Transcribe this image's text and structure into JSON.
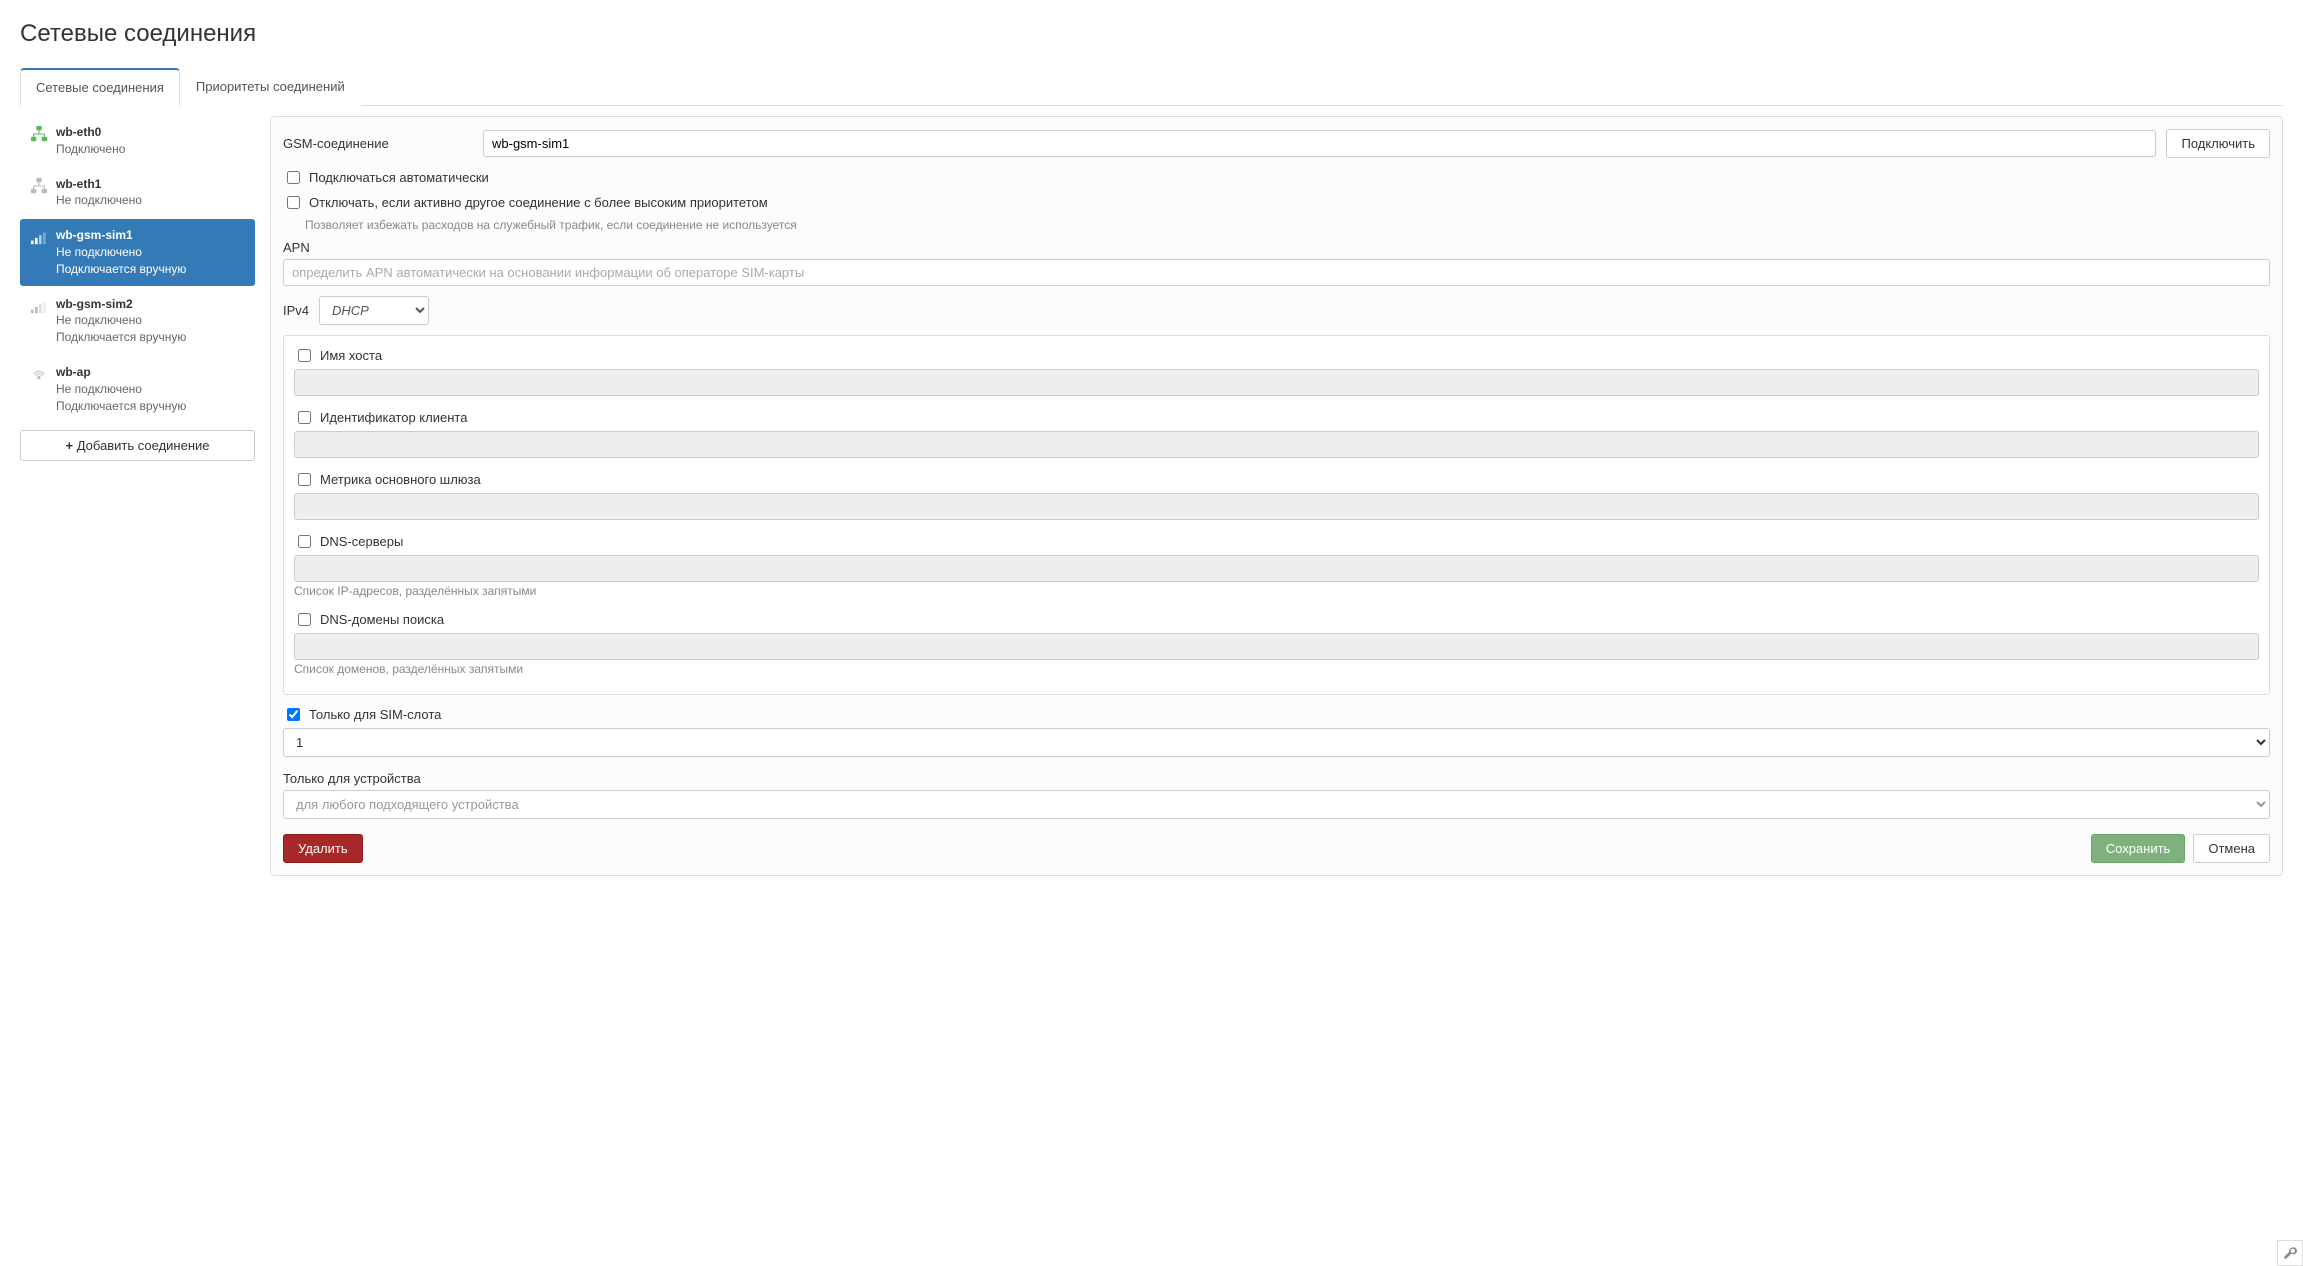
{
  "pageTitle": "Сетевые соединения",
  "tabs": {
    "connections": "Сетевые соединения",
    "priorities": "Приоритеты соединений"
  },
  "sidebar": {
    "items": [
      {
        "name": "wb-eth0",
        "status": "Подключено",
        "extra": "",
        "icon": "ethernet-green"
      },
      {
        "name": "wb-eth1",
        "status": "Не подключено",
        "extra": "",
        "icon": "ethernet-grey"
      },
      {
        "name": "wb-gsm-sim1",
        "status": "Не подключено",
        "extra": "Подключается вручную",
        "icon": "cellular"
      },
      {
        "name": "wb-gsm-sim2",
        "status": "Не подключено",
        "extra": "Подключается вручную",
        "icon": "cellular"
      },
      {
        "name": "wb-ap",
        "status": "Не подключено",
        "extra": "Подключается вручную",
        "icon": "wifi"
      }
    ],
    "addLabel": "Добавить соединение"
  },
  "form": {
    "connLabel": "GSM-соединение",
    "connValue": "wb-gsm-sim1",
    "connectBtn": "Подключить",
    "autoConnect": {
      "label": "Подключаться автоматически"
    },
    "disableHigher": {
      "label": "Отключать, если активно другое соединение с более высоким приоритетом",
      "help": "Позволяет избежать расходов на служебный трафик, если соединение не используется"
    },
    "apnLabel": "APN",
    "apnPlaceholder": "определить APN автоматически на основании информации об операторе SIM-карты",
    "ipv4Label": "IPv4",
    "ipv4Value": "DHCP",
    "hostname": "Имя хоста",
    "clientId": "Идентификатор клиента",
    "gatewayMetric": "Метрика основного шлюза",
    "dnsServers": "DNS-серверы",
    "dnsServersHelp": "Список IP-адресов, разделённых запятыми",
    "dnsDomains": "DNS-домены поиска",
    "dnsDomainsHelp": "Список доменов, разделённых запятыми",
    "simSlot": {
      "label": "Только для SIM-слота",
      "value": "1"
    },
    "deviceOnly": {
      "label": "Только для устройства",
      "placeholder": "для любого подходящего устройства"
    },
    "deleteBtn": "Удалить",
    "saveBtn": "Сохранить",
    "cancelBtn": "Отмена"
  }
}
